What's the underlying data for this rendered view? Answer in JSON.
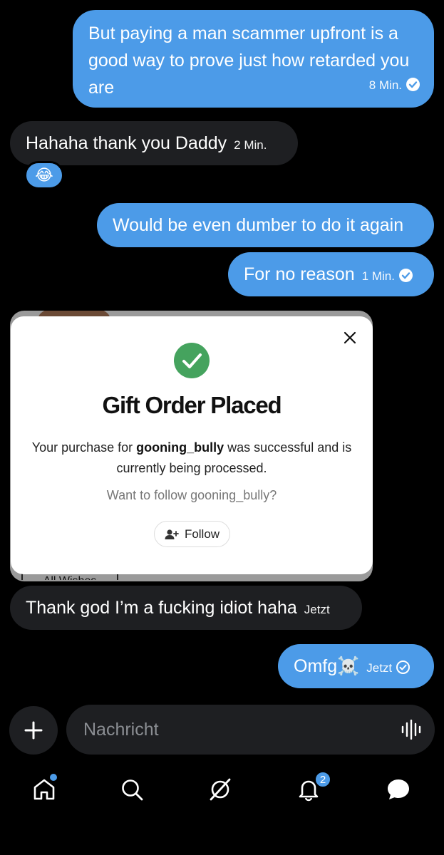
{
  "messages": [
    {
      "id": "m1",
      "direction": "outgoing",
      "text": "But paying a man scammer upfront is a good way to prove just how retarded you are",
      "time": "8 Min.",
      "read": true
    },
    {
      "id": "m2",
      "direction": "incoming",
      "text": "Hahaha thank you Daddy",
      "time": "2 Min.",
      "reaction": "😂"
    },
    {
      "id": "m3",
      "direction": "outgoing",
      "text": "Would be even dumber to do it again"
    },
    {
      "id": "m4",
      "direction": "outgoing",
      "text": "For no reason",
      "time": "1 Min.",
      "read": true
    },
    {
      "id": "m5",
      "direction": "incoming",
      "text": "Thank god I’m a fucking idiot haha",
      "time": "Jetzt"
    },
    {
      "id": "m6",
      "direction": "outgoing",
      "text": "Omfg☠️",
      "time": "Jetzt",
      "read": false
    }
  ],
  "card": {
    "tab_label": "All Wishes"
  },
  "modal": {
    "title": "Gift Order Placed",
    "body_prefix": "Your purchase for ",
    "username": "gooning_bully",
    "body_suffix": " was successful and is currently being processed.",
    "follow_question": "Want to follow gooning_bully?",
    "follow_label": "Follow"
  },
  "composer": {
    "placeholder": "Nachricht"
  },
  "nav": {
    "items": [
      "home-icon",
      "search-icon",
      "grok-icon",
      "bell-icon",
      "messages-icon"
    ],
    "notification_count": "2"
  },
  "colors": {
    "accent": "#4c9be8",
    "incoming_bubble": "#1e1f22",
    "success": "#45a35e",
    "background": "#000000"
  }
}
